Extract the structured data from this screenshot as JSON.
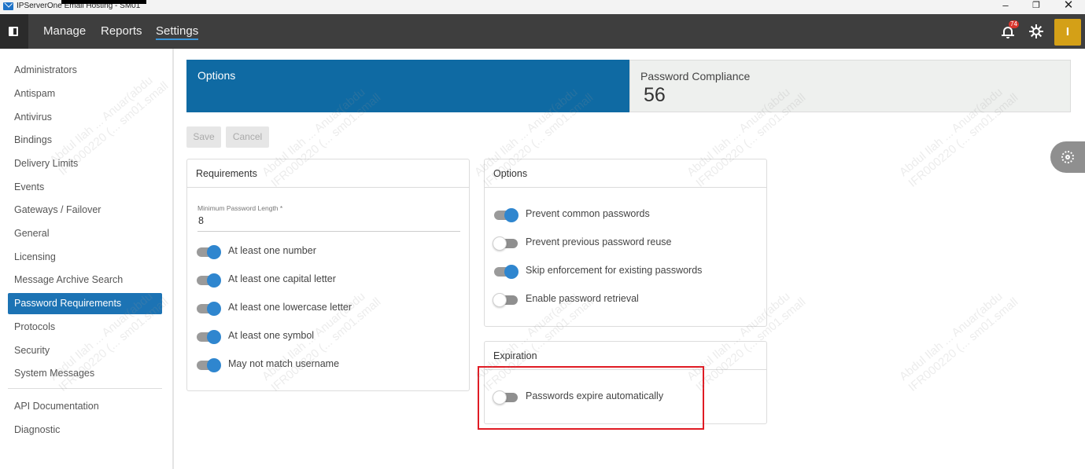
{
  "window": {
    "title": "IPServerOne Email Hosting - SM01",
    "min_glyph": "–",
    "max_glyph": "❐",
    "close_glyph": "✕"
  },
  "nav": {
    "links": [
      "Manage",
      "Reports",
      "Settings"
    ],
    "active": "Settings",
    "notification_count": "74",
    "avatar_letter": "I"
  },
  "sidebar": {
    "items": [
      "Administrators",
      "Antispam",
      "Antivirus",
      "Bindings",
      "Delivery Limits",
      "Events",
      "Gateways / Failover",
      "General",
      "Licensing",
      "Message Archive Search",
      "Password Requirements",
      "Protocols",
      "Security",
      "System Messages"
    ],
    "active": "Password Requirements",
    "footer_items": [
      "API Documentation",
      "Diagnostic"
    ]
  },
  "header": {
    "options_label": "Options",
    "compliance_label": "Password Compliance",
    "compliance_value": "56"
  },
  "actions": {
    "save": "Save",
    "cancel": "Cancel"
  },
  "requirements": {
    "title": "Requirements",
    "min_length_label": "Minimum Password Length *",
    "min_length_value": "8",
    "toggles": [
      {
        "label": "At least one number",
        "on": true
      },
      {
        "label": "At least one capital letter",
        "on": true
      },
      {
        "label": "At least one lowercase letter",
        "on": true
      },
      {
        "label": "At least one symbol",
        "on": true
      },
      {
        "label": "May not match username",
        "on": true
      }
    ]
  },
  "options_panel": {
    "title": "Options",
    "toggles": [
      {
        "label": "Prevent common passwords",
        "on": true
      },
      {
        "label": "Prevent previous password reuse",
        "on": false
      },
      {
        "label": "Skip enforcement for existing passwords",
        "on": true
      },
      {
        "label": "Enable password retrieval",
        "on": false
      }
    ]
  },
  "expiration": {
    "title": "Expiration",
    "toggles": [
      {
        "label": "Passwords expire automatically",
        "on": false
      }
    ]
  },
  "watermark": {
    "line1": "Abdul Ilah ... Anuar(abdu",
    "line2": "IFR000220 (... sm01.small"
  },
  "colors": {
    "nav_bg": "#3e3e3e",
    "accent": "#1c73b4",
    "avatar": "#d4a017",
    "highlight": "#e01b24"
  }
}
